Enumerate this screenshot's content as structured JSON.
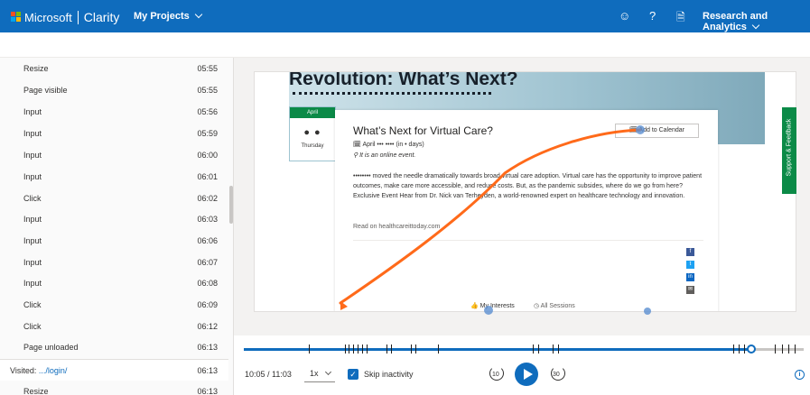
{
  "colors": {
    "accent": "#0f6cbd",
    "green": "#0b8a47",
    "trail": "#ff6a1a"
  },
  "header": {
    "brand": "Microsoft",
    "app": "Clarity",
    "projects": "My Projects",
    "org": "Research and Analytics",
    "icons": [
      "smiley-icon",
      "help-icon",
      "document-icon"
    ]
  },
  "events": [
    {
      "name": "Resize",
      "time": "05:55"
    },
    {
      "name": "Page visible",
      "time": "05:55"
    },
    {
      "name": "Input",
      "time": "05:56"
    },
    {
      "name": "Input",
      "time": "05:59"
    },
    {
      "name": "Input",
      "time": "06:00"
    },
    {
      "name": "Input",
      "time": "06:01"
    },
    {
      "name": "Click",
      "time": "06:02"
    },
    {
      "name": "Input",
      "time": "06:03"
    },
    {
      "name": "Input",
      "time": "06:06"
    },
    {
      "name": "Input",
      "time": "06:07"
    },
    {
      "name": "Input",
      "time": "06:08"
    },
    {
      "name": "Click",
      "time": "06:09"
    },
    {
      "name": "Click",
      "time": "06:12"
    },
    {
      "name": "Page unloaded",
      "time": "06:13"
    }
  ],
  "visited": {
    "label": "Visited:",
    "path": ".../login/",
    "time": "06:13"
  },
  "last_event": {
    "name": "Resize",
    "time": "06:13"
  },
  "recording": {
    "hero_title": "Revolution: What’s Next?",
    "cal_month": "April",
    "cal_day": "● ●",
    "cal_dow": "Thursday",
    "event_title": "What’s Next for Virtual Care?",
    "add_calendar": "Add to Calendar",
    "date_line": "🗓 April ••• •••• (in • days)",
    "online_line": "It is an online event.",
    "description": "•••••••• moved the needle dramatically towards broad virtual care adoption. Virtual care has the opportunity to improve patient outcomes, make care more accessible, and reduce costs. But, as the pandemic subsides, where do we go from here? Exclusive Event Hear from Dr. Nick van Terheyden, a world-renowned expert on healthcare technology and innovation.",
    "read_on": "Read on healthcareittoday.com",
    "interests": "My Interests",
    "all_sessions": "All Sessions",
    "feedback": "Support & Feedback",
    "share_icons": [
      "facebook-icon",
      "twitter-icon",
      "linkedin-icon",
      "email-icon"
    ]
  },
  "controls": {
    "time": "10:05 / 11:03",
    "speed": "1x",
    "skip_label": "Skip inactivity",
    "rewind": "10",
    "forward": "30",
    "progress": 0.907
  }
}
